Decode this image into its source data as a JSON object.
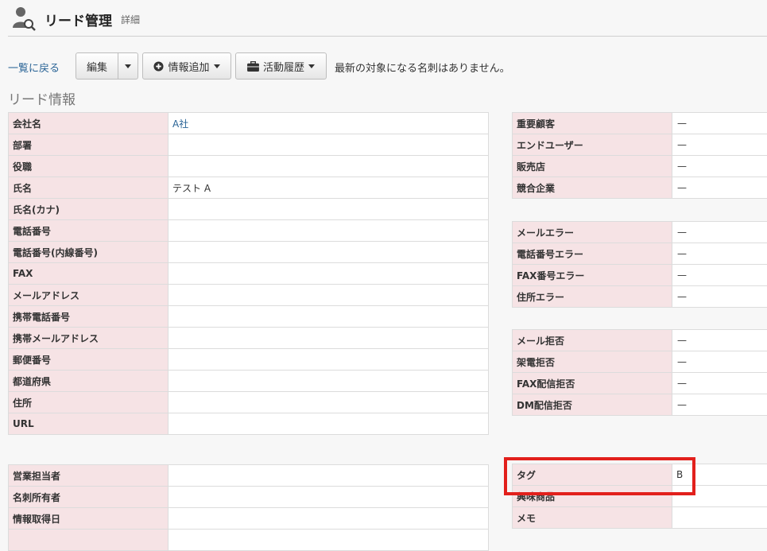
{
  "header": {
    "title": "リード管理",
    "subtitle": "詳細",
    "icon": "user-search-icon"
  },
  "toolbar": {
    "back": "一覧に戻る",
    "edit": "編集",
    "info_add": "情報追加",
    "history": "活動履歴",
    "notice": "最新の対象になる名刺はありません。"
  },
  "section_title": "リード情報",
  "left_main": [
    {
      "k": "会社名",
      "v": "A社",
      "link": true
    },
    {
      "k": "部署",
      "v": ""
    },
    {
      "k": "役職",
      "v": ""
    },
    {
      "k": "氏名",
      "v": "テスト A"
    },
    {
      "k": "氏名(カナ)",
      "v": ""
    },
    {
      "k": "電話番号",
      "v": ""
    },
    {
      "k": "電話番号(内線番号)",
      "v": ""
    },
    {
      "k": "FAX",
      "v": ""
    },
    {
      "k": "メールアドレス",
      "v": ""
    },
    {
      "k": "携帯電話番号",
      "v": ""
    },
    {
      "k": "携帯メールアドレス",
      "v": ""
    },
    {
      "k": "郵便番号",
      "v": ""
    },
    {
      "k": "都道府県",
      "v": ""
    },
    {
      "k": "住所",
      "v": ""
    },
    {
      "k": "URL",
      "v": ""
    }
  ],
  "left_owner": [
    {
      "k": "営業担当者",
      "v": ""
    },
    {
      "k": "名刺所有者",
      "v": ""
    },
    {
      "k": "情報取得日",
      "v": ""
    },
    {
      "k": "",
      "v": ""
    }
  ],
  "right_1": [
    {
      "k": "重要顧客",
      "v": "—"
    },
    {
      "k": "エンドユーザー",
      "v": "—"
    },
    {
      "k": "販売店",
      "v": "—"
    },
    {
      "k": "競合企業",
      "v": "—"
    }
  ],
  "right_2": [
    {
      "k": "メールエラー",
      "v": "—"
    },
    {
      "k": "電話番号エラー",
      "v": "—"
    },
    {
      "k": "FAX番号エラー",
      "v": "—"
    },
    {
      "k": "住所エラー",
      "v": "—"
    }
  ],
  "right_3": [
    {
      "k": "メール拒否",
      "v": "—"
    },
    {
      "k": "架電拒否",
      "v": "—"
    },
    {
      "k": "FAX配信拒否",
      "v": "—"
    },
    {
      "k": "DM配信拒否",
      "v": "—"
    }
  ],
  "right_4": [
    {
      "k": "タグ",
      "v": "B"
    },
    {
      "k": "興味商品",
      "v": ""
    },
    {
      "k": "メモ",
      "v": ""
    }
  ],
  "colors": {
    "label_bg": "#f6e3e5",
    "link": "#2a6496",
    "highlight": "#e2201c"
  }
}
